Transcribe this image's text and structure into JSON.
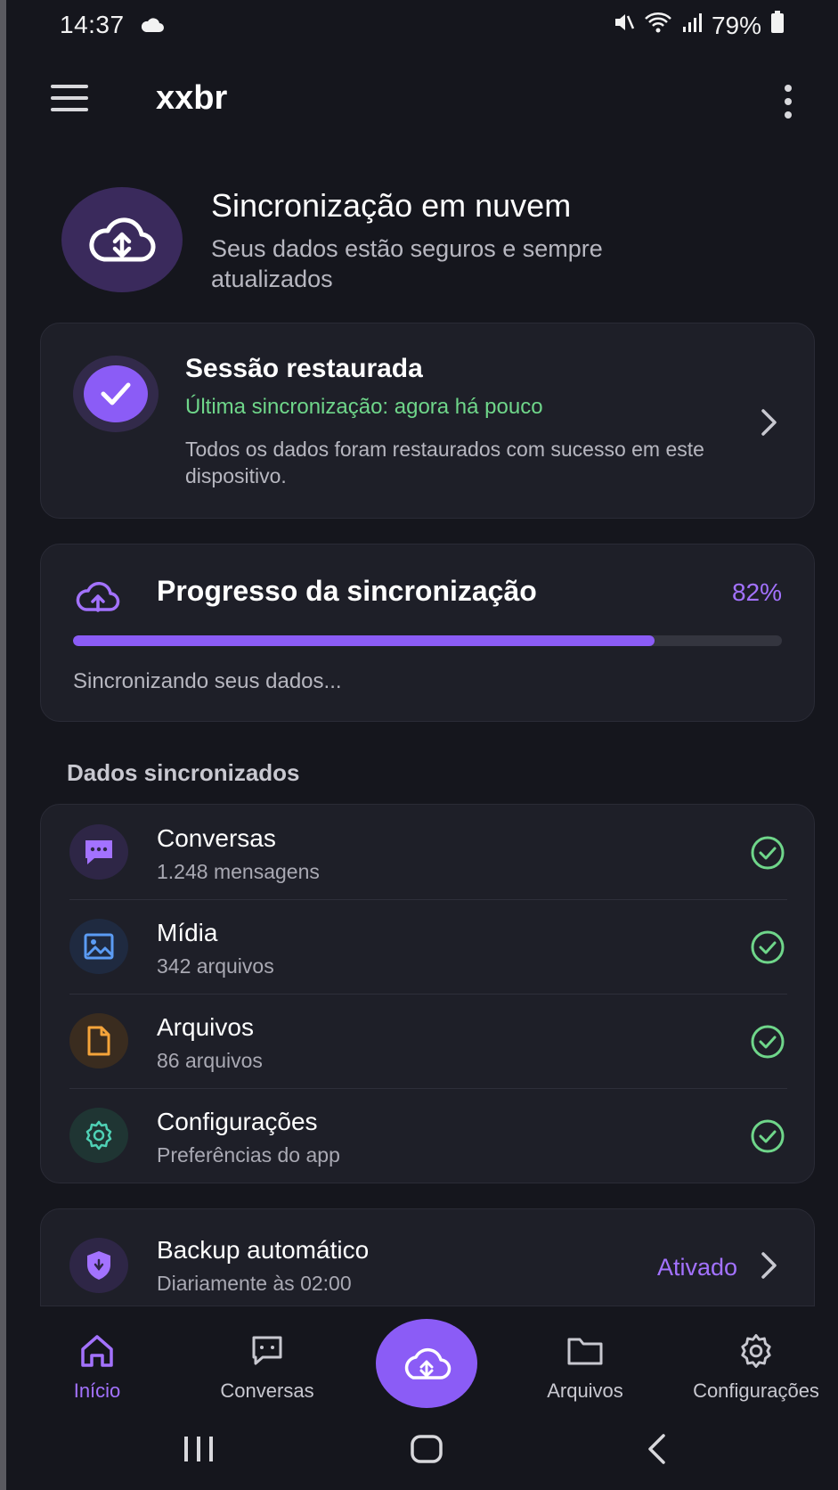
{
  "status_bar": {
    "time": "14:37",
    "battery": "79%",
    "icons": [
      "cloud-icon",
      "mute-icon",
      "wifi-icon",
      "signal-icon",
      "battery-icon"
    ]
  },
  "app_bar": {
    "title": "xxbr",
    "menu_icon": "hamburger-menu-icon",
    "more_icon": "more-vertical-icon"
  },
  "hero": {
    "title": "Sincronização em nuvem",
    "subtitle": "Seus dados estão seguros e sempre atualizados",
    "icon": "cloud-sync-icon"
  },
  "session": {
    "title": "Sessão restaurada",
    "last_sync": "Última sincronização: agora há pouco",
    "description": "Todos os dados foram restaurados com sucesso em este dispositivo.",
    "icon": "check-icon"
  },
  "progress": {
    "title": "Progresso da sincronização",
    "percent_label": "82%",
    "value": 0.82,
    "status": "Sincronizando seus dados...",
    "icon": "cloud-upload-icon"
  },
  "synced": {
    "section_label": "Dados sincronizados",
    "items": [
      {
        "title": "Conversas",
        "subtitle": "1.248 mensagens",
        "icon": "chat-icon",
        "color": "#a372ff",
        "bg": "#2e2646"
      },
      {
        "title": "Mídia",
        "subtitle": "342 arquivos",
        "icon": "image-icon",
        "color": "#5b9cf5",
        "bg": "#1f2a40"
      },
      {
        "title": "Arquivos",
        "subtitle": "86 arquivos",
        "icon": "file-icon",
        "color": "#f5a43a",
        "bg": "#3a2c1f"
      },
      {
        "title": "Configurações",
        "subtitle": "Preferências do app",
        "icon": "gear-icon",
        "color": "#4fd1b5",
        "bg": "#1f3533"
      }
    ]
  },
  "backup": {
    "title": "Backup automático",
    "subtitle": "Diariamente às 02:00",
    "status": "Ativado",
    "icon": "shield-icon"
  },
  "bottom_nav": {
    "items": [
      {
        "label": "Início",
        "icon": "home-icon",
        "active": true
      },
      {
        "label": "Conversas",
        "icon": "chat-icon",
        "active": false
      },
      {
        "label": "Arquivos",
        "icon": "folder-icon",
        "active": false
      },
      {
        "label": "Configurações",
        "icon": "gear-icon",
        "active": false
      }
    ],
    "fab_icon": "cloud-sync-icon"
  },
  "colors": {
    "background": "#15161d",
    "card": "#1e1f28",
    "accent": "#8b5cf6",
    "success": "#6fd68a"
  }
}
